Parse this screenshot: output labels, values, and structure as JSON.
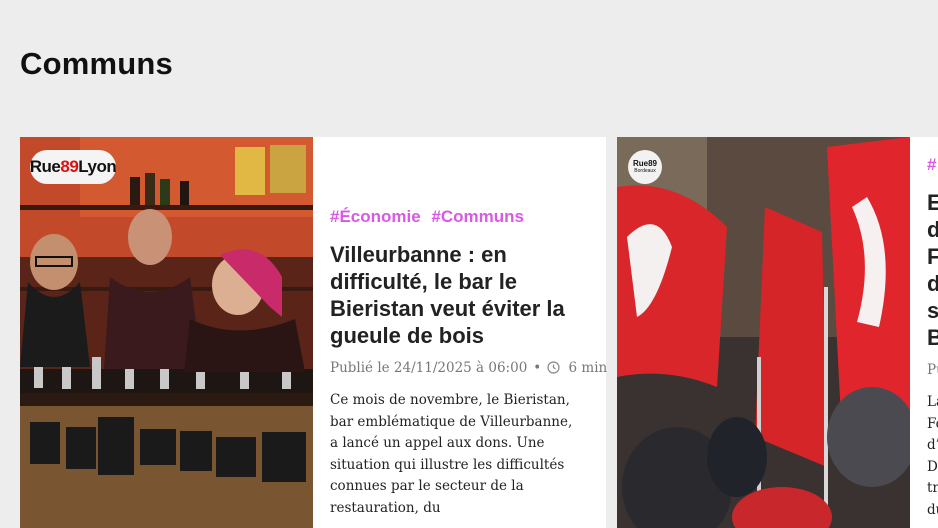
{
  "section": {
    "title": "Communs"
  },
  "cards": [
    {
      "logo": {
        "text_a": "Rue",
        "text_b": "89",
        "text_c": "Lyon"
      },
      "tags": [
        "#Économie",
        "#Communs"
      ],
      "title": "Villeurbanne : en difficulté, le bar le Bieristan veut éviter la gueule de bois",
      "published": "Publié le 24/11/2025 à 06:00",
      "separator": "•",
      "read_time": "6 min",
      "excerpt": "Ce mois de novembre, le Bieristan, bar emblématique de Villeurbanne, a lancé un appel aux dons. Une situation qui illustre les difficultés connues par le secteur de la restauration, du"
    },
    {
      "logo": {
        "text_a": "Rue89",
        "text_b": "Bordeaux"
      },
      "tags": [
        "#"
      ],
      "title_lines": [
        "E",
        "d",
        "F",
        "d",
        "s",
        "B"
      ],
      "published": "Pu",
      "excerpt_lines": [
        "La",
        "Fo",
        "d’i",
        "D",
        "tr",
        "du"
      ]
    }
  ],
  "colors": {
    "accent": "#d958e4",
    "background": "#ededed",
    "card": "#ffffff"
  }
}
